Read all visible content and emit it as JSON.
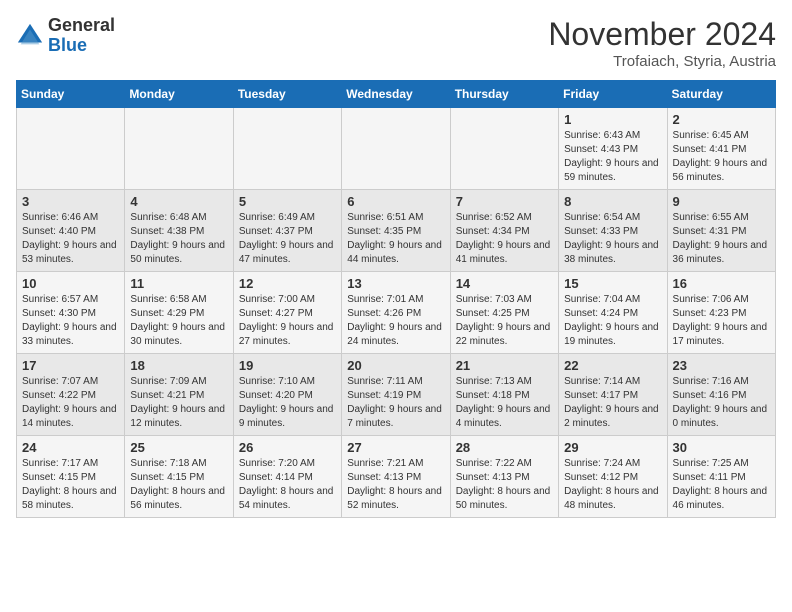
{
  "header": {
    "logo_general": "General",
    "logo_blue": "Blue",
    "month_title": "November 2024",
    "subtitle": "Trofaiach, Styria, Austria"
  },
  "days_of_week": [
    "Sunday",
    "Monday",
    "Tuesday",
    "Wednesday",
    "Thursday",
    "Friday",
    "Saturday"
  ],
  "weeks": [
    [
      {
        "day": "",
        "info": ""
      },
      {
        "day": "",
        "info": ""
      },
      {
        "day": "",
        "info": ""
      },
      {
        "day": "",
        "info": ""
      },
      {
        "day": "",
        "info": ""
      },
      {
        "day": "1",
        "info": "Sunrise: 6:43 AM\nSunset: 4:43 PM\nDaylight: 9 hours and 59 minutes."
      },
      {
        "day": "2",
        "info": "Sunrise: 6:45 AM\nSunset: 4:41 PM\nDaylight: 9 hours and 56 minutes."
      }
    ],
    [
      {
        "day": "3",
        "info": "Sunrise: 6:46 AM\nSunset: 4:40 PM\nDaylight: 9 hours and 53 minutes."
      },
      {
        "day": "4",
        "info": "Sunrise: 6:48 AM\nSunset: 4:38 PM\nDaylight: 9 hours and 50 minutes."
      },
      {
        "day": "5",
        "info": "Sunrise: 6:49 AM\nSunset: 4:37 PM\nDaylight: 9 hours and 47 minutes."
      },
      {
        "day": "6",
        "info": "Sunrise: 6:51 AM\nSunset: 4:35 PM\nDaylight: 9 hours and 44 minutes."
      },
      {
        "day": "7",
        "info": "Sunrise: 6:52 AM\nSunset: 4:34 PM\nDaylight: 9 hours and 41 minutes."
      },
      {
        "day": "8",
        "info": "Sunrise: 6:54 AM\nSunset: 4:33 PM\nDaylight: 9 hours and 38 minutes."
      },
      {
        "day": "9",
        "info": "Sunrise: 6:55 AM\nSunset: 4:31 PM\nDaylight: 9 hours and 36 minutes."
      }
    ],
    [
      {
        "day": "10",
        "info": "Sunrise: 6:57 AM\nSunset: 4:30 PM\nDaylight: 9 hours and 33 minutes."
      },
      {
        "day": "11",
        "info": "Sunrise: 6:58 AM\nSunset: 4:29 PM\nDaylight: 9 hours and 30 minutes."
      },
      {
        "day": "12",
        "info": "Sunrise: 7:00 AM\nSunset: 4:27 PM\nDaylight: 9 hours and 27 minutes."
      },
      {
        "day": "13",
        "info": "Sunrise: 7:01 AM\nSunset: 4:26 PM\nDaylight: 9 hours and 24 minutes."
      },
      {
        "day": "14",
        "info": "Sunrise: 7:03 AM\nSunset: 4:25 PM\nDaylight: 9 hours and 22 minutes."
      },
      {
        "day": "15",
        "info": "Sunrise: 7:04 AM\nSunset: 4:24 PM\nDaylight: 9 hours and 19 minutes."
      },
      {
        "day": "16",
        "info": "Sunrise: 7:06 AM\nSunset: 4:23 PM\nDaylight: 9 hours and 17 minutes."
      }
    ],
    [
      {
        "day": "17",
        "info": "Sunrise: 7:07 AM\nSunset: 4:22 PM\nDaylight: 9 hours and 14 minutes."
      },
      {
        "day": "18",
        "info": "Sunrise: 7:09 AM\nSunset: 4:21 PM\nDaylight: 9 hours and 12 minutes."
      },
      {
        "day": "19",
        "info": "Sunrise: 7:10 AM\nSunset: 4:20 PM\nDaylight: 9 hours and 9 minutes."
      },
      {
        "day": "20",
        "info": "Sunrise: 7:11 AM\nSunset: 4:19 PM\nDaylight: 9 hours and 7 minutes."
      },
      {
        "day": "21",
        "info": "Sunrise: 7:13 AM\nSunset: 4:18 PM\nDaylight: 9 hours and 4 minutes."
      },
      {
        "day": "22",
        "info": "Sunrise: 7:14 AM\nSunset: 4:17 PM\nDaylight: 9 hours and 2 minutes."
      },
      {
        "day": "23",
        "info": "Sunrise: 7:16 AM\nSunset: 4:16 PM\nDaylight: 9 hours and 0 minutes."
      }
    ],
    [
      {
        "day": "24",
        "info": "Sunrise: 7:17 AM\nSunset: 4:15 PM\nDaylight: 8 hours and 58 minutes."
      },
      {
        "day": "25",
        "info": "Sunrise: 7:18 AM\nSunset: 4:15 PM\nDaylight: 8 hours and 56 minutes."
      },
      {
        "day": "26",
        "info": "Sunrise: 7:20 AM\nSunset: 4:14 PM\nDaylight: 8 hours and 54 minutes."
      },
      {
        "day": "27",
        "info": "Sunrise: 7:21 AM\nSunset: 4:13 PM\nDaylight: 8 hours and 52 minutes."
      },
      {
        "day": "28",
        "info": "Sunrise: 7:22 AM\nSunset: 4:13 PM\nDaylight: 8 hours and 50 minutes."
      },
      {
        "day": "29",
        "info": "Sunrise: 7:24 AM\nSunset: 4:12 PM\nDaylight: 8 hours and 48 minutes."
      },
      {
        "day": "30",
        "info": "Sunrise: 7:25 AM\nSunset: 4:11 PM\nDaylight: 8 hours and 46 minutes."
      }
    ]
  ]
}
